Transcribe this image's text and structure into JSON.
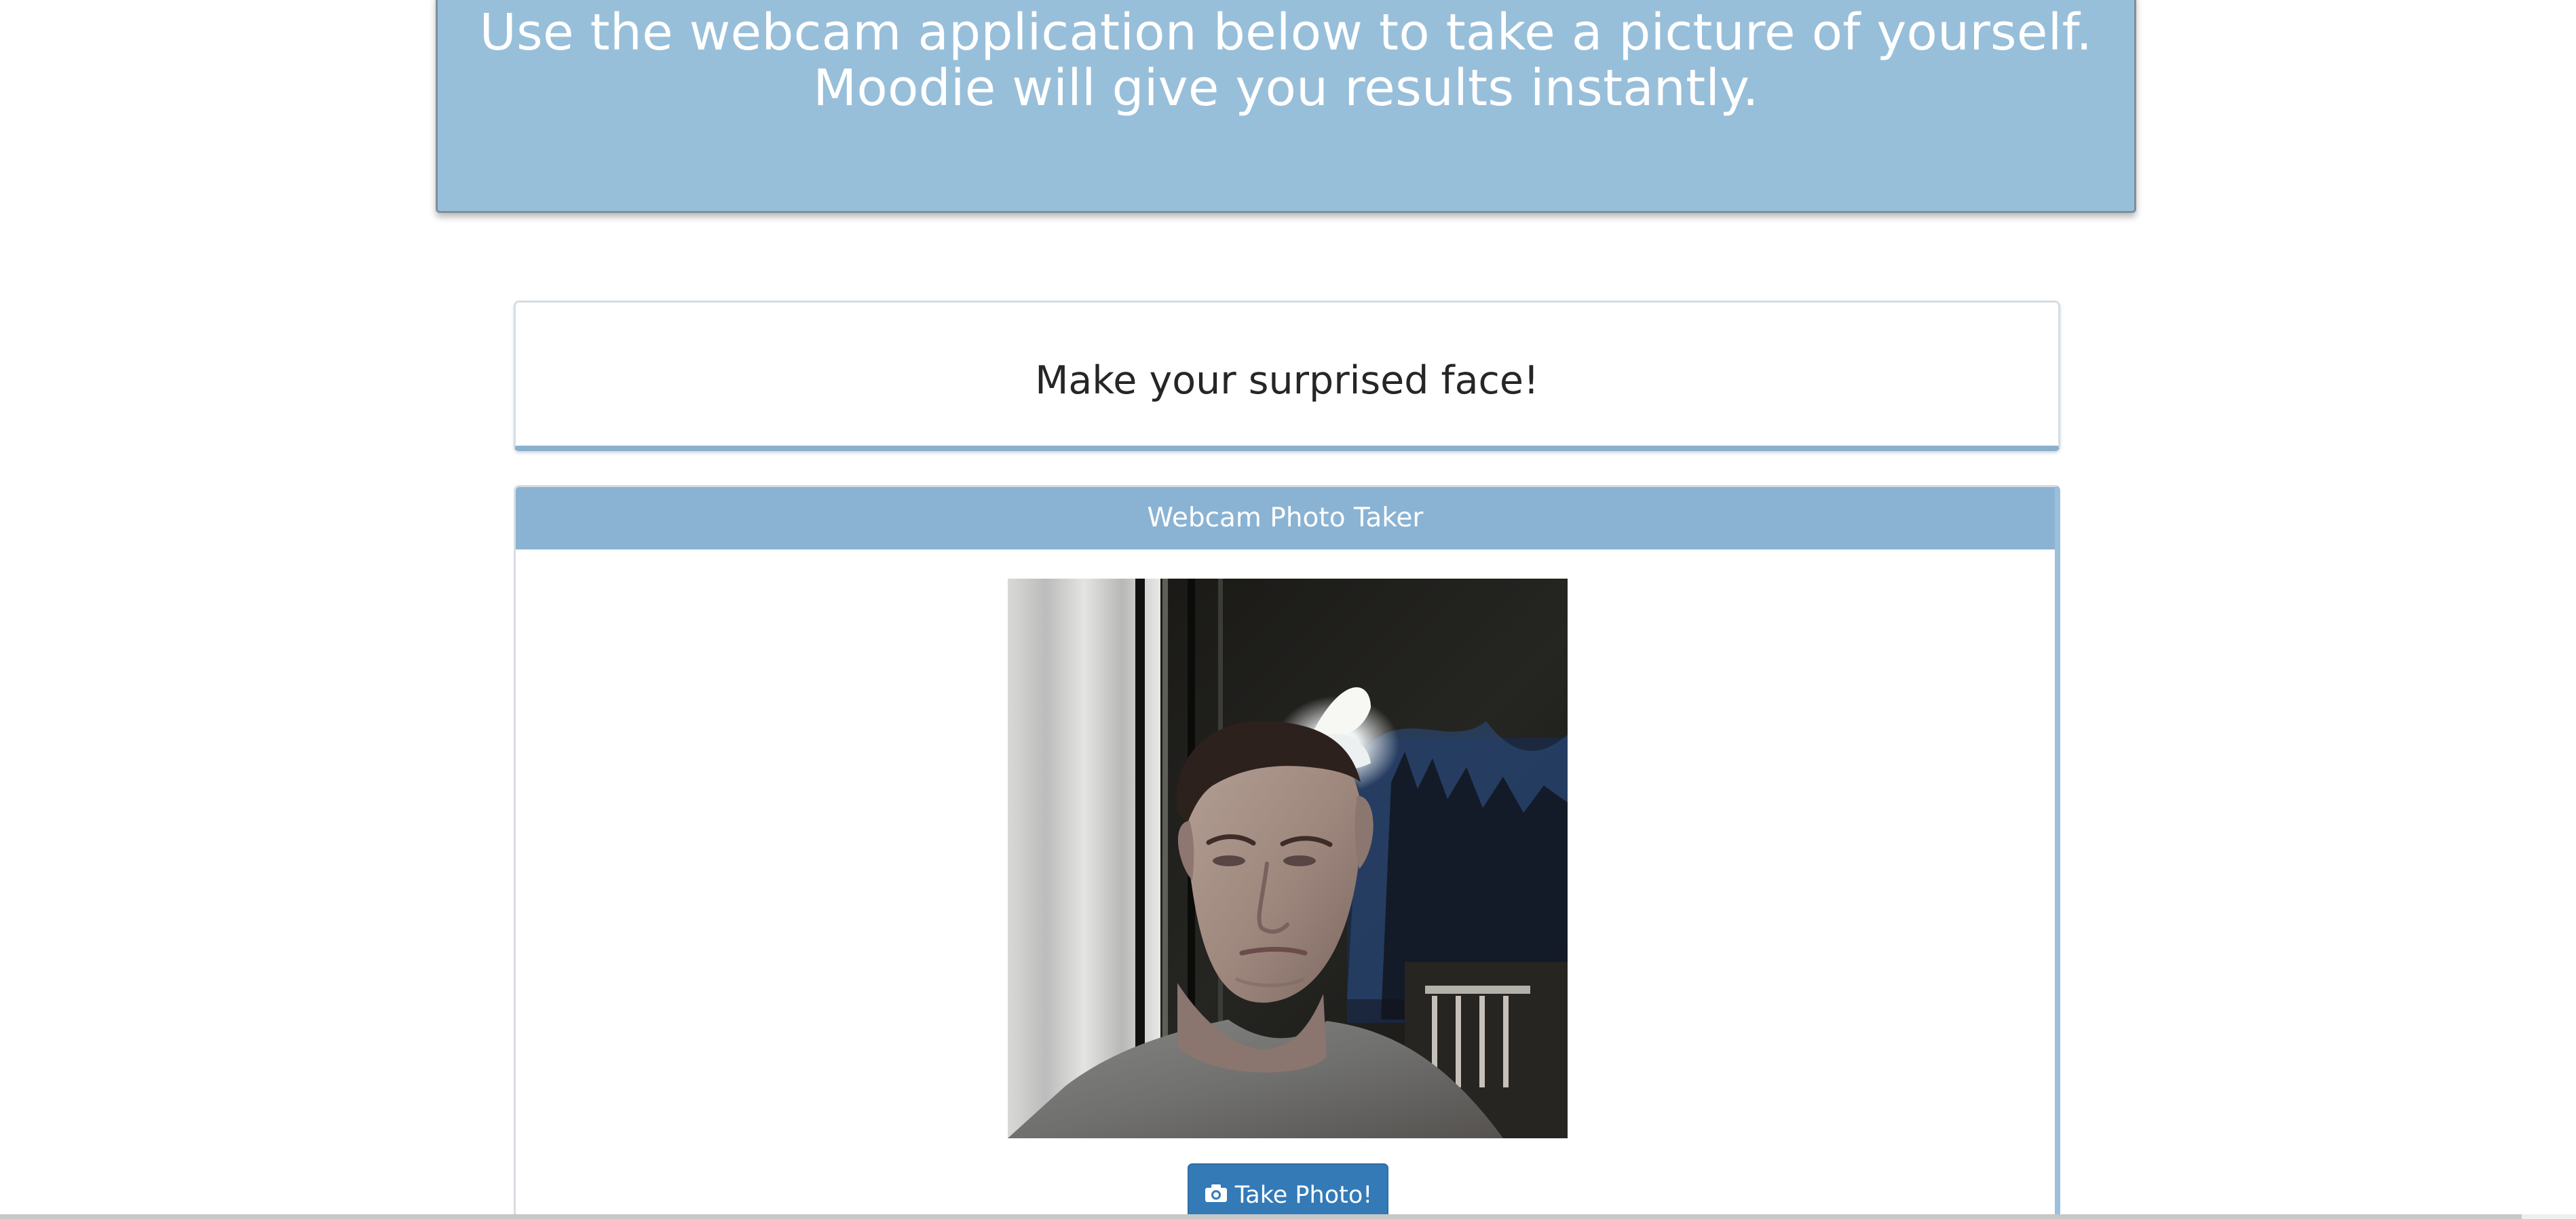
{
  "hero": {
    "text": "Use the webcam application below to take a picture of yourself. Moodie will give you results instantly."
  },
  "prompt": {
    "text": "Make your surprised face!"
  },
  "webcam": {
    "title": "Webcam Photo Taker",
    "button_label": "Take Photo!",
    "button_icon": "camera-icon"
  },
  "colors": {
    "hero_background": "#98bfda",
    "panel_header": "#8ab3d3",
    "button": "#337ab7",
    "card_accent": "#8ab0cc"
  }
}
